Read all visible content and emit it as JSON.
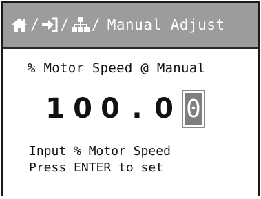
{
  "header": {
    "breadcrumb_icons": [
      "home-icon",
      "login-arrow-icon",
      "network-icon"
    ],
    "separator": "/",
    "title": "Manual Adjust"
  },
  "subtitle": "% Motor Speed @ Manual",
  "value": {
    "digits": [
      "1",
      "0",
      "0",
      ".",
      "0"
    ],
    "cursor_digit": "0"
  },
  "help": {
    "line1": "Input % Motor Speed",
    "line2": "Press ENTER to set"
  },
  "colors": {
    "header_bg": "#9c9c9c",
    "cursor_bg": "#7f7f7f",
    "text": "#111111"
  }
}
